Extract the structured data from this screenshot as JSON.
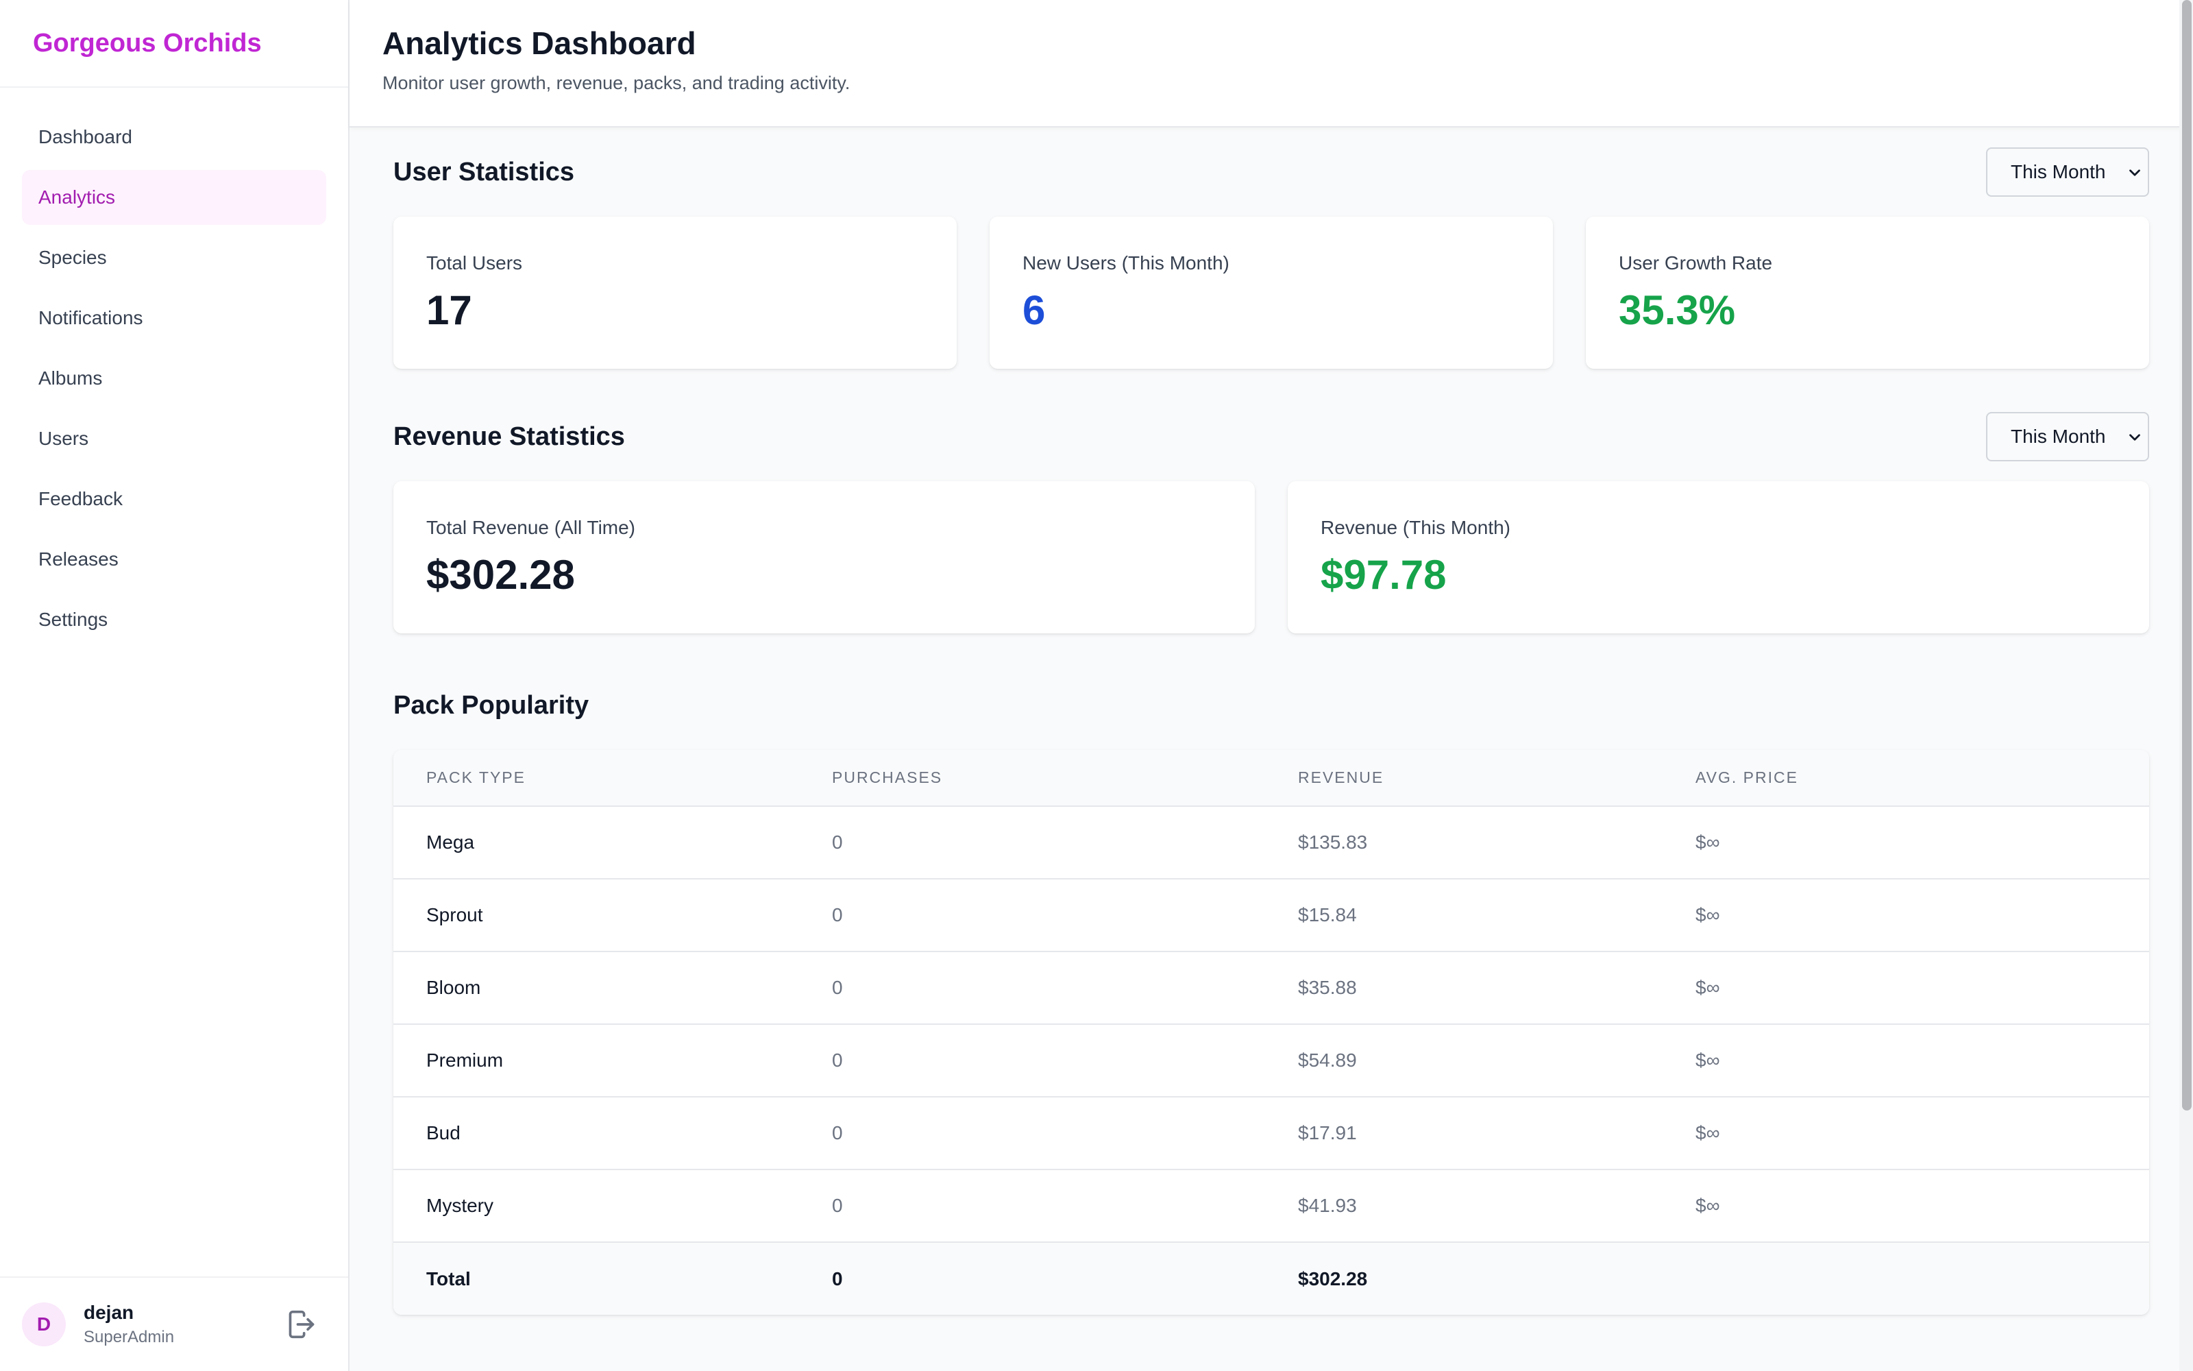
{
  "brand": "Gorgeous Orchids",
  "nav": [
    {
      "label": "Dashboard"
    },
    {
      "label": "Analytics",
      "active": true
    },
    {
      "label": "Species"
    },
    {
      "label": "Notifications"
    },
    {
      "label": "Albums"
    },
    {
      "label": "Users"
    },
    {
      "label": "Feedback"
    },
    {
      "label": "Releases"
    },
    {
      "label": "Settings"
    }
  ],
  "user": {
    "initial": "D",
    "name": "dejan",
    "role": "SuperAdmin",
    "logout_icon": "logout-icon"
  },
  "header": {
    "title": "Analytics Dashboard",
    "subtitle": "Monitor user growth, revenue, packs, and trading activity."
  },
  "user_stats": {
    "title": "User Statistics",
    "period": "This Month",
    "cards": [
      {
        "label": "Total Users",
        "value": "17",
        "color": "#111827"
      },
      {
        "label": "New Users (This Month)",
        "value": "6",
        "color": "#1d4ed8"
      },
      {
        "label": "User Growth Rate",
        "value": "35.3%",
        "color": "#16a34a"
      }
    ]
  },
  "revenue_stats": {
    "title": "Revenue Statistics",
    "period": "This Month",
    "cards": [
      {
        "label": "Total Revenue (All Time)",
        "value": "$302.28",
        "color": "#111827"
      },
      {
        "label": "Revenue (This Month)",
        "value": "$97.78",
        "color": "#16a34a"
      }
    ]
  },
  "pack_popularity": {
    "title": "Pack Popularity",
    "columns": [
      "PACK TYPE",
      "PURCHASES",
      "REVENUE",
      "AVG. PRICE"
    ],
    "rows": [
      {
        "pack": "Mega",
        "purchases": "0",
        "revenue": "$135.83",
        "avg": "$∞"
      },
      {
        "pack": "Sprout",
        "purchases": "0",
        "revenue": "$15.84",
        "avg": "$∞"
      },
      {
        "pack": "Bloom",
        "purchases": "0",
        "revenue": "$35.88",
        "avg": "$∞"
      },
      {
        "pack": "Premium",
        "purchases": "0",
        "revenue": "$54.89",
        "avg": "$∞"
      },
      {
        "pack": "Bud",
        "purchases": "0",
        "revenue": "$17.91",
        "avg": "$∞"
      },
      {
        "pack": "Mystery",
        "purchases": "0",
        "revenue": "$41.93",
        "avg": "$∞"
      }
    ],
    "total": {
      "label": "Total",
      "purchases": "0",
      "revenue": "$302.28",
      "avg": ""
    }
  }
}
